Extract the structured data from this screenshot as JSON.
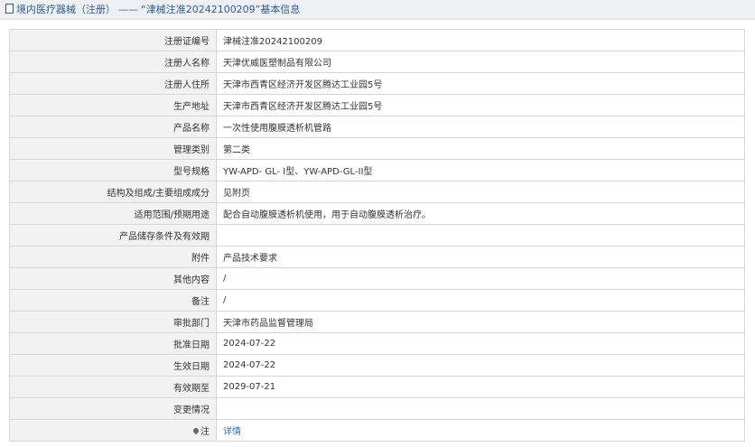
{
  "header": {
    "prefix": "境内医疗器械（注册）",
    "separator": "——",
    "title": "“津械注准20242100209”基本信息"
  },
  "rows": [
    {
      "label": "注册证编号",
      "value": "津械注准20242100209"
    },
    {
      "label": "注册人名称",
      "value": "天津优威医塑制品有限公司"
    },
    {
      "label": "注册人住所",
      "value": "天津市西青区经济开发区腾达工业园5号"
    },
    {
      "label": "生产地址",
      "value": "天津市西青区经济开发区腾达工业园5号"
    },
    {
      "label": "产品名称",
      "value": "一次性使用腹膜透析机管路"
    },
    {
      "label": "管理类别",
      "value": "第二类"
    },
    {
      "label": "型号规格",
      "value": "YW-APD- GL- I型、YW-APD-GL-II型"
    },
    {
      "label": "结构及组成/主要组成成分",
      "value": "见附页"
    },
    {
      "label": "适用范围/预期用途",
      "value": "配合自动腹膜透析机使用，用于自动腹膜透析治疗。"
    },
    {
      "label": "产品储存条件及有效期",
      "value": ""
    },
    {
      "label": "附件",
      "value": "产品技术要求"
    },
    {
      "label": "其他内容",
      "value": "/"
    },
    {
      "label": "备注",
      "value": "/"
    },
    {
      "label": "审批部门",
      "value": "天津市药品监督管理局"
    },
    {
      "label": "批准日期",
      "value": "2024-07-22"
    },
    {
      "label": "生效日期",
      "value": "2024-07-22"
    },
    {
      "label": "有效期至",
      "value": "2029-07-21"
    },
    {
      "label": "变更情况",
      "value": ""
    }
  ],
  "note": {
    "label": "注",
    "link": "详情",
    "icon": "pin-icon"
  }
}
